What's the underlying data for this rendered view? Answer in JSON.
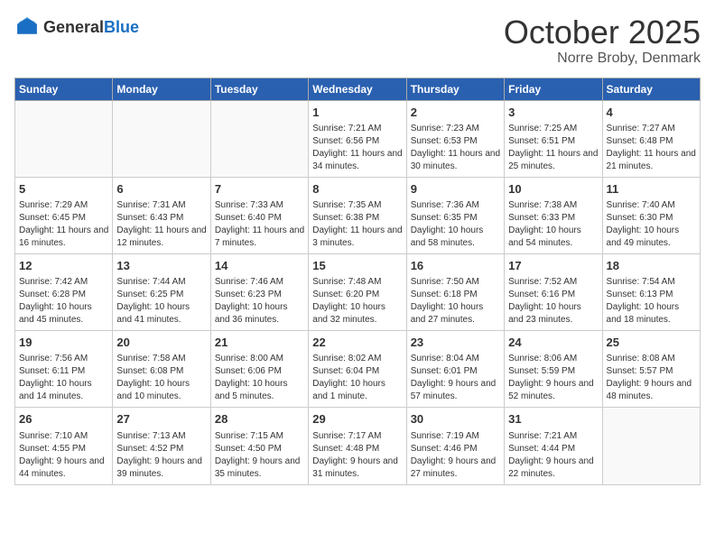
{
  "header": {
    "logo_general": "General",
    "logo_blue": "Blue",
    "month_title": "October 2025",
    "location": "Norre Broby, Denmark"
  },
  "weekdays": [
    "Sunday",
    "Monday",
    "Tuesday",
    "Wednesday",
    "Thursday",
    "Friday",
    "Saturday"
  ],
  "weeks": [
    [
      {
        "day": "",
        "info": ""
      },
      {
        "day": "",
        "info": ""
      },
      {
        "day": "",
        "info": ""
      },
      {
        "day": "1",
        "info": "Sunrise: 7:21 AM\nSunset: 6:56 PM\nDaylight: 11 hours and 34 minutes."
      },
      {
        "day": "2",
        "info": "Sunrise: 7:23 AM\nSunset: 6:53 PM\nDaylight: 11 hours and 30 minutes."
      },
      {
        "day": "3",
        "info": "Sunrise: 7:25 AM\nSunset: 6:51 PM\nDaylight: 11 hours and 25 minutes."
      },
      {
        "day": "4",
        "info": "Sunrise: 7:27 AM\nSunset: 6:48 PM\nDaylight: 11 hours and 21 minutes."
      }
    ],
    [
      {
        "day": "5",
        "info": "Sunrise: 7:29 AM\nSunset: 6:45 PM\nDaylight: 11 hours and 16 minutes."
      },
      {
        "day": "6",
        "info": "Sunrise: 7:31 AM\nSunset: 6:43 PM\nDaylight: 11 hours and 12 minutes."
      },
      {
        "day": "7",
        "info": "Sunrise: 7:33 AM\nSunset: 6:40 PM\nDaylight: 11 hours and 7 minutes."
      },
      {
        "day": "8",
        "info": "Sunrise: 7:35 AM\nSunset: 6:38 PM\nDaylight: 11 hours and 3 minutes."
      },
      {
        "day": "9",
        "info": "Sunrise: 7:36 AM\nSunset: 6:35 PM\nDaylight: 10 hours and 58 minutes."
      },
      {
        "day": "10",
        "info": "Sunrise: 7:38 AM\nSunset: 6:33 PM\nDaylight: 10 hours and 54 minutes."
      },
      {
        "day": "11",
        "info": "Sunrise: 7:40 AM\nSunset: 6:30 PM\nDaylight: 10 hours and 49 minutes."
      }
    ],
    [
      {
        "day": "12",
        "info": "Sunrise: 7:42 AM\nSunset: 6:28 PM\nDaylight: 10 hours and 45 minutes."
      },
      {
        "day": "13",
        "info": "Sunrise: 7:44 AM\nSunset: 6:25 PM\nDaylight: 10 hours and 41 minutes."
      },
      {
        "day": "14",
        "info": "Sunrise: 7:46 AM\nSunset: 6:23 PM\nDaylight: 10 hours and 36 minutes."
      },
      {
        "day": "15",
        "info": "Sunrise: 7:48 AM\nSunset: 6:20 PM\nDaylight: 10 hours and 32 minutes."
      },
      {
        "day": "16",
        "info": "Sunrise: 7:50 AM\nSunset: 6:18 PM\nDaylight: 10 hours and 27 minutes."
      },
      {
        "day": "17",
        "info": "Sunrise: 7:52 AM\nSunset: 6:16 PM\nDaylight: 10 hours and 23 minutes."
      },
      {
        "day": "18",
        "info": "Sunrise: 7:54 AM\nSunset: 6:13 PM\nDaylight: 10 hours and 18 minutes."
      }
    ],
    [
      {
        "day": "19",
        "info": "Sunrise: 7:56 AM\nSunset: 6:11 PM\nDaylight: 10 hours and 14 minutes."
      },
      {
        "day": "20",
        "info": "Sunrise: 7:58 AM\nSunset: 6:08 PM\nDaylight: 10 hours and 10 minutes."
      },
      {
        "day": "21",
        "info": "Sunrise: 8:00 AM\nSunset: 6:06 PM\nDaylight: 10 hours and 5 minutes."
      },
      {
        "day": "22",
        "info": "Sunrise: 8:02 AM\nSunset: 6:04 PM\nDaylight: 10 hours and 1 minute."
      },
      {
        "day": "23",
        "info": "Sunrise: 8:04 AM\nSunset: 6:01 PM\nDaylight: 9 hours and 57 minutes."
      },
      {
        "day": "24",
        "info": "Sunrise: 8:06 AM\nSunset: 5:59 PM\nDaylight: 9 hours and 52 minutes."
      },
      {
        "day": "25",
        "info": "Sunrise: 8:08 AM\nSunset: 5:57 PM\nDaylight: 9 hours and 48 minutes."
      }
    ],
    [
      {
        "day": "26",
        "info": "Sunrise: 7:10 AM\nSunset: 4:55 PM\nDaylight: 9 hours and 44 minutes."
      },
      {
        "day": "27",
        "info": "Sunrise: 7:13 AM\nSunset: 4:52 PM\nDaylight: 9 hours and 39 minutes."
      },
      {
        "day": "28",
        "info": "Sunrise: 7:15 AM\nSunset: 4:50 PM\nDaylight: 9 hours and 35 minutes."
      },
      {
        "day": "29",
        "info": "Sunrise: 7:17 AM\nSunset: 4:48 PM\nDaylight: 9 hours and 31 minutes."
      },
      {
        "day": "30",
        "info": "Sunrise: 7:19 AM\nSunset: 4:46 PM\nDaylight: 9 hours and 27 minutes."
      },
      {
        "day": "31",
        "info": "Sunrise: 7:21 AM\nSunset: 4:44 PM\nDaylight: 9 hours and 22 minutes."
      },
      {
        "day": "",
        "info": ""
      }
    ]
  ]
}
